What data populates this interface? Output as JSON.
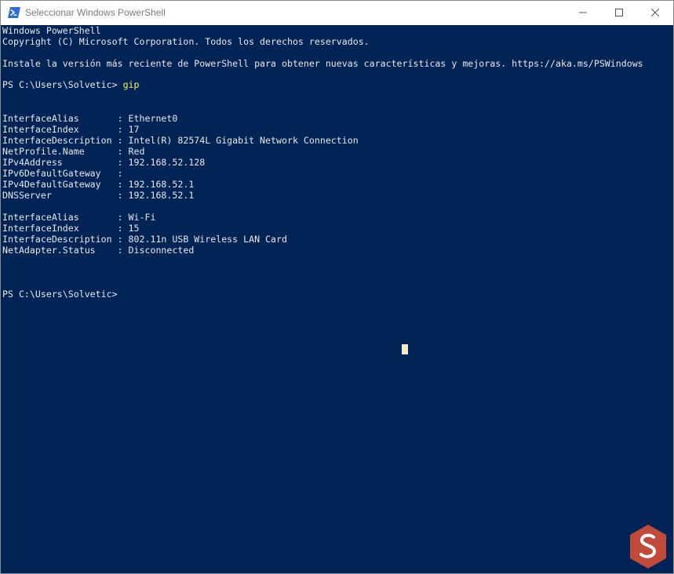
{
  "window": {
    "title": "Seleccionar Windows PowerShell",
    "icons": {
      "app": "powershell-icon",
      "minimize": "minimize-icon",
      "maximize": "maximize-icon",
      "close": "close-icon"
    }
  },
  "console": {
    "banner": [
      "Windows PowerShell",
      "Copyright (C) Microsoft Corporation. Todos los derechos reservados.",
      "Instale la versión más reciente de PowerShell para obtener nuevas características y mejoras. https://aka.ms/PSWindows"
    ],
    "prompt1": "PS C:\\Users\\Solvetic>",
    "command": "gip",
    "output": [
      "InterfaceAlias       : Ethernet0",
      "InterfaceIndex       : 17",
      "InterfaceDescription : Intel(R) 82574L Gigabit Network Connection",
      "NetProfile.Name      : Red",
      "IPv4Address          : 192.168.52.128",
      "IPv6DefaultGateway   :",
      "IPv4DefaultGateway   : 192.168.52.1",
      "DNSServer            : 192.168.52.1",
      "InterfaceAlias       : Wi-Fi",
      "InterfaceIndex       : 15",
      "InterfaceDescription : 802.11n USB Wireless LAN Card",
      "NetAdapter.Status    : Disconnected"
    ],
    "prompt2": "PS C:\\Users\\Solvetic>",
    "colors": {
      "background": "#012456",
      "text": "#e8e8e8",
      "command": "#f3f35a",
      "cursor": "#f8e8c4"
    }
  },
  "watermark": {
    "icon": "solvetic-logo-icon"
  }
}
